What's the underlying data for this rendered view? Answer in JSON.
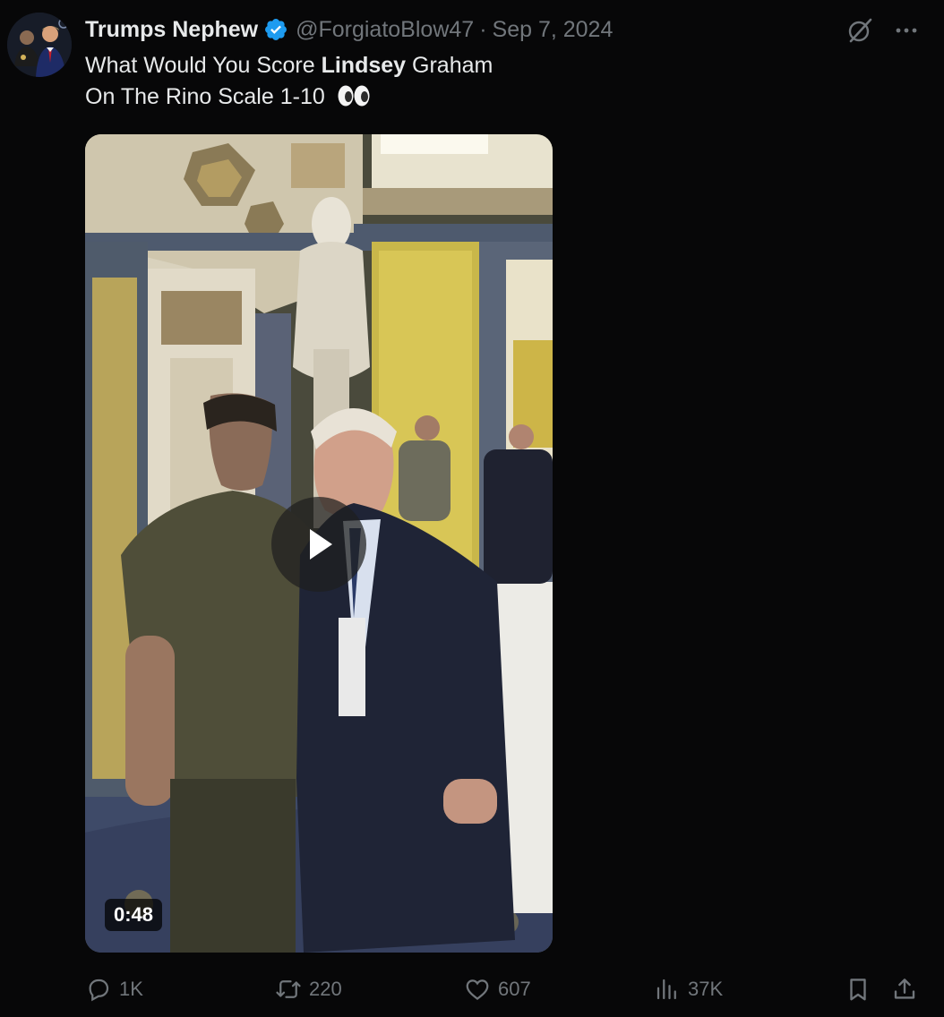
{
  "author": {
    "display_name": "Trumps Nephew",
    "handle": "@ForgiatoBlow47",
    "separator": "·",
    "date": "Sep 7, 2024",
    "verified": true,
    "verified_color": "#1d9bf0"
  },
  "tweet": {
    "text_part1": "What Would You Score ",
    "text_bold": "Lindsey",
    "text_part2": " Graham",
    "text_line2": "On The Rino Scale 1-10",
    "emoji": "eyes-emoji"
  },
  "media": {
    "type": "video",
    "duration": "0:48"
  },
  "actions": {
    "reply_count": "1K",
    "repost_count": "220",
    "like_count": "607",
    "views_count": "37K"
  },
  "colors": {
    "background": "#070708",
    "text_primary": "#e7e9ea",
    "text_secondary": "#71767b"
  }
}
